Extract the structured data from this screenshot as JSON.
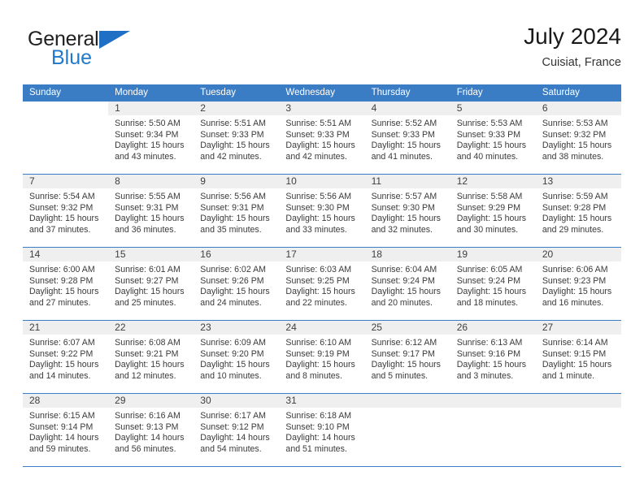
{
  "brand": {
    "name_part1": "General",
    "name_part2": "Blue",
    "accent_color": "#2179c9"
  },
  "header": {
    "title": "July 2024",
    "location": "Cuisiat, France"
  },
  "calendar": {
    "header_bg": "#3b7dc4",
    "weekdays": [
      "Sunday",
      "Monday",
      "Tuesday",
      "Wednesday",
      "Thursday",
      "Friday",
      "Saturday"
    ],
    "weeks": [
      [
        {
          "day": "",
          "lines": []
        },
        {
          "day": "1",
          "lines": [
            "Sunrise: 5:50 AM",
            "Sunset: 9:34 PM",
            "Daylight: 15 hours",
            "and 43 minutes."
          ]
        },
        {
          "day": "2",
          "lines": [
            "Sunrise: 5:51 AM",
            "Sunset: 9:33 PM",
            "Daylight: 15 hours",
            "and 42 minutes."
          ]
        },
        {
          "day": "3",
          "lines": [
            "Sunrise: 5:51 AM",
            "Sunset: 9:33 PM",
            "Daylight: 15 hours",
            "and 42 minutes."
          ]
        },
        {
          "day": "4",
          "lines": [
            "Sunrise: 5:52 AM",
            "Sunset: 9:33 PM",
            "Daylight: 15 hours",
            "and 41 minutes."
          ]
        },
        {
          "day": "5",
          "lines": [
            "Sunrise: 5:53 AM",
            "Sunset: 9:33 PM",
            "Daylight: 15 hours",
            "and 40 minutes."
          ]
        },
        {
          "day": "6",
          "lines": [
            "Sunrise: 5:53 AM",
            "Sunset: 9:32 PM",
            "Daylight: 15 hours",
            "and 38 minutes."
          ]
        }
      ],
      [
        {
          "day": "7",
          "lines": [
            "Sunrise: 5:54 AM",
            "Sunset: 9:32 PM",
            "Daylight: 15 hours",
            "and 37 minutes."
          ]
        },
        {
          "day": "8",
          "lines": [
            "Sunrise: 5:55 AM",
            "Sunset: 9:31 PM",
            "Daylight: 15 hours",
            "and 36 minutes."
          ]
        },
        {
          "day": "9",
          "lines": [
            "Sunrise: 5:56 AM",
            "Sunset: 9:31 PM",
            "Daylight: 15 hours",
            "and 35 minutes."
          ]
        },
        {
          "day": "10",
          "lines": [
            "Sunrise: 5:56 AM",
            "Sunset: 9:30 PM",
            "Daylight: 15 hours",
            "and 33 minutes."
          ]
        },
        {
          "day": "11",
          "lines": [
            "Sunrise: 5:57 AM",
            "Sunset: 9:30 PM",
            "Daylight: 15 hours",
            "and 32 minutes."
          ]
        },
        {
          "day": "12",
          "lines": [
            "Sunrise: 5:58 AM",
            "Sunset: 9:29 PM",
            "Daylight: 15 hours",
            "and 30 minutes."
          ]
        },
        {
          "day": "13",
          "lines": [
            "Sunrise: 5:59 AM",
            "Sunset: 9:28 PM",
            "Daylight: 15 hours",
            "and 29 minutes."
          ]
        }
      ],
      [
        {
          "day": "14",
          "lines": [
            "Sunrise: 6:00 AM",
            "Sunset: 9:28 PM",
            "Daylight: 15 hours",
            "and 27 minutes."
          ]
        },
        {
          "day": "15",
          "lines": [
            "Sunrise: 6:01 AM",
            "Sunset: 9:27 PM",
            "Daylight: 15 hours",
            "and 25 minutes."
          ]
        },
        {
          "day": "16",
          "lines": [
            "Sunrise: 6:02 AM",
            "Sunset: 9:26 PM",
            "Daylight: 15 hours",
            "and 24 minutes."
          ]
        },
        {
          "day": "17",
          "lines": [
            "Sunrise: 6:03 AM",
            "Sunset: 9:25 PM",
            "Daylight: 15 hours",
            "and 22 minutes."
          ]
        },
        {
          "day": "18",
          "lines": [
            "Sunrise: 6:04 AM",
            "Sunset: 9:24 PM",
            "Daylight: 15 hours",
            "and 20 minutes."
          ]
        },
        {
          "day": "19",
          "lines": [
            "Sunrise: 6:05 AM",
            "Sunset: 9:24 PM",
            "Daylight: 15 hours",
            "and 18 minutes."
          ]
        },
        {
          "day": "20",
          "lines": [
            "Sunrise: 6:06 AM",
            "Sunset: 9:23 PM",
            "Daylight: 15 hours",
            "and 16 minutes."
          ]
        }
      ],
      [
        {
          "day": "21",
          "lines": [
            "Sunrise: 6:07 AM",
            "Sunset: 9:22 PM",
            "Daylight: 15 hours",
            "and 14 minutes."
          ]
        },
        {
          "day": "22",
          "lines": [
            "Sunrise: 6:08 AM",
            "Sunset: 9:21 PM",
            "Daylight: 15 hours",
            "and 12 minutes."
          ]
        },
        {
          "day": "23",
          "lines": [
            "Sunrise: 6:09 AM",
            "Sunset: 9:20 PM",
            "Daylight: 15 hours",
            "and 10 minutes."
          ]
        },
        {
          "day": "24",
          "lines": [
            "Sunrise: 6:10 AM",
            "Sunset: 9:19 PM",
            "Daylight: 15 hours",
            "and 8 minutes."
          ]
        },
        {
          "day": "25",
          "lines": [
            "Sunrise: 6:12 AM",
            "Sunset: 9:17 PM",
            "Daylight: 15 hours",
            "and 5 minutes."
          ]
        },
        {
          "day": "26",
          "lines": [
            "Sunrise: 6:13 AM",
            "Sunset: 9:16 PM",
            "Daylight: 15 hours",
            "and 3 minutes."
          ]
        },
        {
          "day": "27",
          "lines": [
            "Sunrise: 6:14 AM",
            "Sunset: 9:15 PM",
            "Daylight: 15 hours",
            "and 1 minute."
          ]
        }
      ],
      [
        {
          "day": "28",
          "lines": [
            "Sunrise: 6:15 AM",
            "Sunset: 9:14 PM",
            "Daylight: 14 hours",
            "and 59 minutes."
          ]
        },
        {
          "day": "29",
          "lines": [
            "Sunrise: 6:16 AM",
            "Sunset: 9:13 PM",
            "Daylight: 14 hours",
            "and 56 minutes."
          ]
        },
        {
          "day": "30",
          "lines": [
            "Sunrise: 6:17 AM",
            "Sunset: 9:12 PM",
            "Daylight: 14 hours",
            "and 54 minutes."
          ]
        },
        {
          "day": "31",
          "lines": [
            "Sunrise: 6:18 AM",
            "Sunset: 9:10 PM",
            "Daylight: 14 hours",
            "and 51 minutes."
          ]
        },
        {
          "day": "",
          "lines": []
        },
        {
          "day": "",
          "lines": []
        },
        {
          "day": "",
          "lines": []
        }
      ]
    ]
  }
}
